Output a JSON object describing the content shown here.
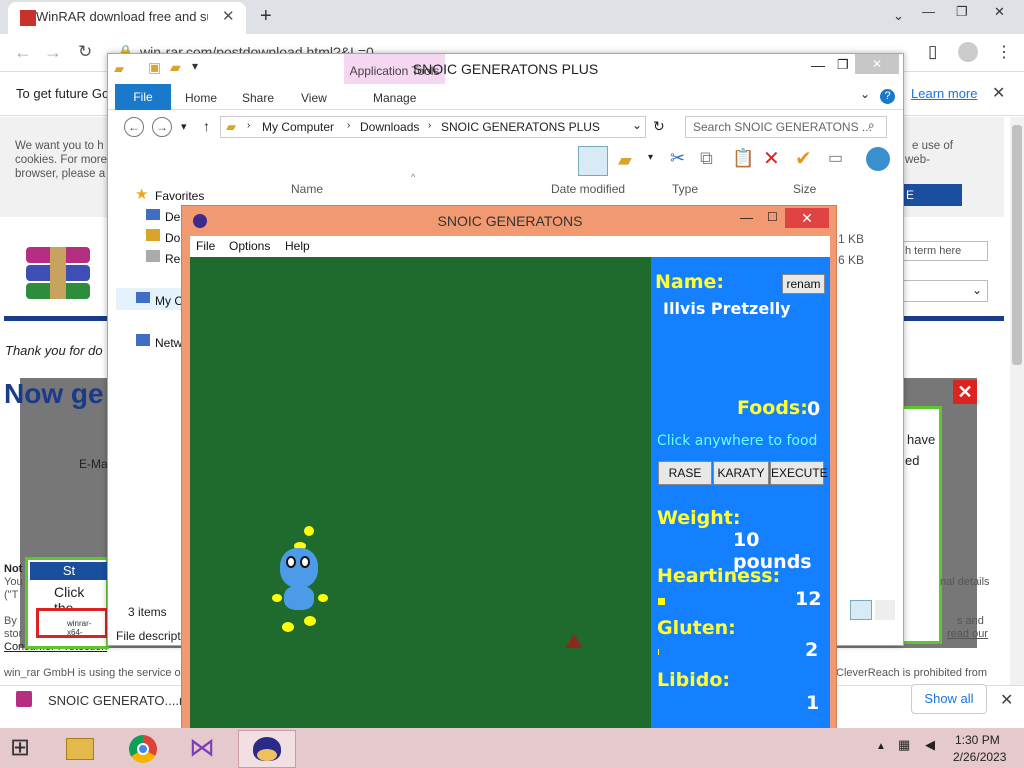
{
  "browser": {
    "tab_title": "WinRAR download free and supp",
    "url": "win-rar.com/postdownload.html?&L=0",
    "infobar_text": "To get future Go",
    "learn_more": "Learn more",
    "download_item": "SNOIC GENERATO....rar",
    "show_all": "Show all"
  },
  "page": {
    "cookie_left": "We want you to h\ncookies. For more\nbrowser, please a",
    "cookie_right_1": "e use of",
    "cookie_right_2": "web-",
    "search_hint": "h term here",
    "thank_you": "Thank you for do",
    "now_get": "Now ge",
    "email_label": "E-Ma",
    "popup_have": "have",
    "popup_ed": "ed",
    "note": "Not",
    "you": "You",
    "tn": "(\"T",
    "by": "By",
    "stor": "stor",
    "consumer": "Consumer Protection",
    "winrar_gmbh": "win_rar GmbH is using the service o",
    "cleverreach": "CleverReach is prohibited from",
    "right_details": "nal details",
    "right_s_and": "s and",
    "right_read": "read our",
    "st_label": "St",
    "click_the": "Click the",
    "winrar_file": "winrar-x64-",
    "e_btn": "E"
  },
  "explorer": {
    "title": "SNOIC GENERATONS PLUS",
    "app_tools": "Application Tools",
    "tabs": [
      "File",
      "Home",
      "Share",
      "View",
      "Manage"
    ],
    "path": [
      "My Computer",
      "Downloads",
      "SNOIC GENERATONS PLUS"
    ],
    "search_placeholder": "Search SNOIC GENERATONS ...",
    "columns": [
      "Name",
      "Date modified",
      "Type",
      "Size"
    ],
    "sizes": [
      "1 KB",
      "6 KB"
    ],
    "nav": [
      "Favorites",
      "Des",
      "Do",
      "Rec",
      "My C",
      "Netw"
    ],
    "items_count": "3 items",
    "file_desc": "File descripti"
  },
  "game": {
    "title": "SNOIC GENERATONS",
    "menu": [
      "File",
      "Options",
      "Help"
    ],
    "name_label": "Name:",
    "rename_button": "renam",
    "pet_name": "Illvis Pretzelly",
    "foods_label": "Foods:",
    "foods_value": "0",
    "hint": "Click anywhere to food",
    "buttons": [
      "RASE",
      "KARATY",
      "EXECUTE"
    ],
    "weight_label": "Weight:",
    "weight_value": "10 pounds",
    "heartiness_label": "Heartiness:",
    "heartiness_value": "12",
    "gluten_label": "Gluten:",
    "gluten_value": "2",
    "libido_label": "Libido:",
    "libido_value": "1"
  },
  "taskbar": {
    "time": "1:30 PM",
    "date": "2/26/2023"
  },
  "colors": {
    "field": "#1e6b2d",
    "panel": "#1480ff",
    "label_yellow": "#ffff33",
    "window_frame": "#f19a72"
  }
}
